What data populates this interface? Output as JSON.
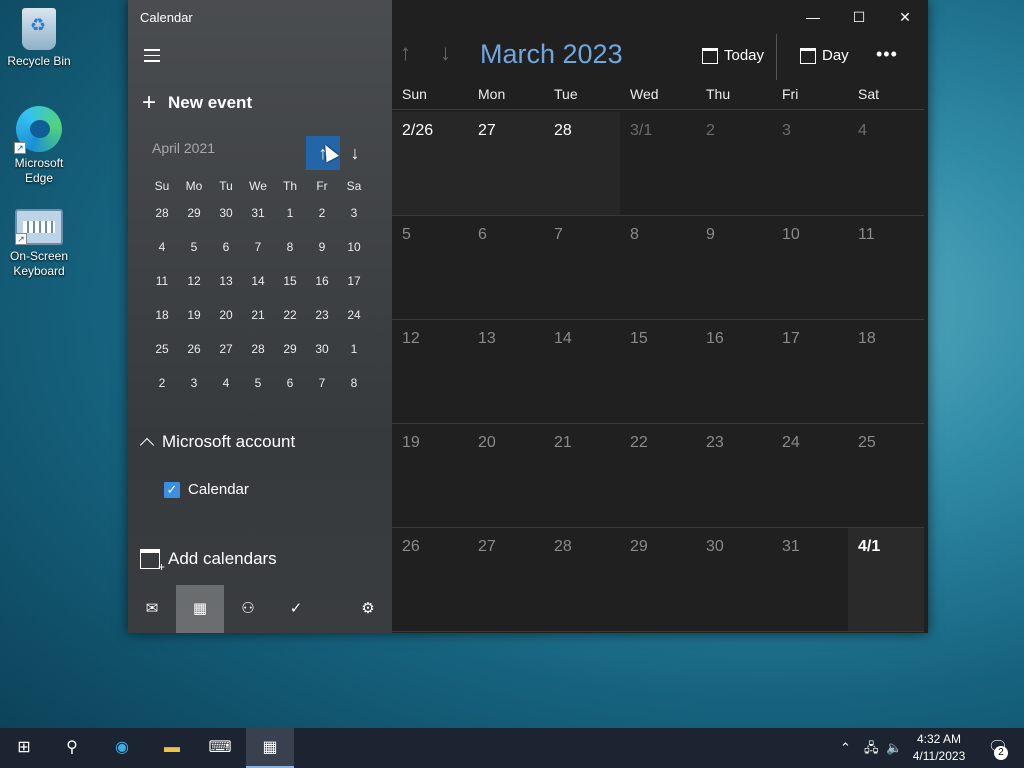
{
  "desktop": {
    "icons": [
      {
        "label": "Recycle Bin"
      },
      {
        "label": "Microsoft Edge"
      },
      {
        "label": "On-Screen Keyboard"
      }
    ]
  },
  "window": {
    "title": "Calendar",
    "controls": {
      "minimize": "—",
      "maximize": "☐",
      "close": "✕"
    }
  },
  "sidebar": {
    "new_event": "New event",
    "mini_calendar": {
      "month": "April 2021",
      "weekdays": [
        "Su",
        "Mo",
        "Tu",
        "We",
        "Th",
        "Fr",
        "Sa"
      ],
      "weeks": [
        [
          "28",
          "29",
          "30",
          "31",
          "1",
          "2",
          "3"
        ],
        [
          "4",
          "5",
          "6",
          "7",
          "8",
          "9",
          "10"
        ],
        [
          "11",
          "12",
          "13",
          "14",
          "15",
          "16",
          "17"
        ],
        [
          "18",
          "19",
          "20",
          "21",
          "22",
          "23",
          "24"
        ],
        [
          "25",
          "26",
          "27",
          "28",
          "29",
          "30",
          "1"
        ],
        [
          "2",
          "3",
          "4",
          "5",
          "6",
          "7",
          "8"
        ]
      ]
    },
    "account": "Microsoft account",
    "calendar_item": {
      "label": "Calendar",
      "checked": true
    },
    "add_calendars": "Add calendars"
  },
  "main": {
    "month_title": "March 2023",
    "today_label": "Today",
    "view_label": "Day",
    "more": "•••",
    "weekdays": [
      "Sun",
      "Mon",
      "Tue",
      "Wed",
      "Thu",
      "Fri",
      "Sat"
    ],
    "weeks": [
      [
        "2/26",
        "27",
        "28",
        "3/1",
        "2",
        "3",
        "4"
      ],
      [
        "5",
        "6",
        "7",
        "8",
        "9",
        "10",
        "11"
      ],
      [
        "12",
        "13",
        "14",
        "15",
        "16",
        "17",
        "18"
      ],
      [
        "19",
        "20",
        "21",
        "22",
        "23",
        "24",
        "25"
      ],
      [
        "26",
        "27",
        "28",
        "29",
        "30",
        "31",
        "4/1"
      ]
    ]
  },
  "taskbar": {
    "time": "4:32 AM",
    "date": "4/11/2023",
    "notification_count": "2"
  }
}
